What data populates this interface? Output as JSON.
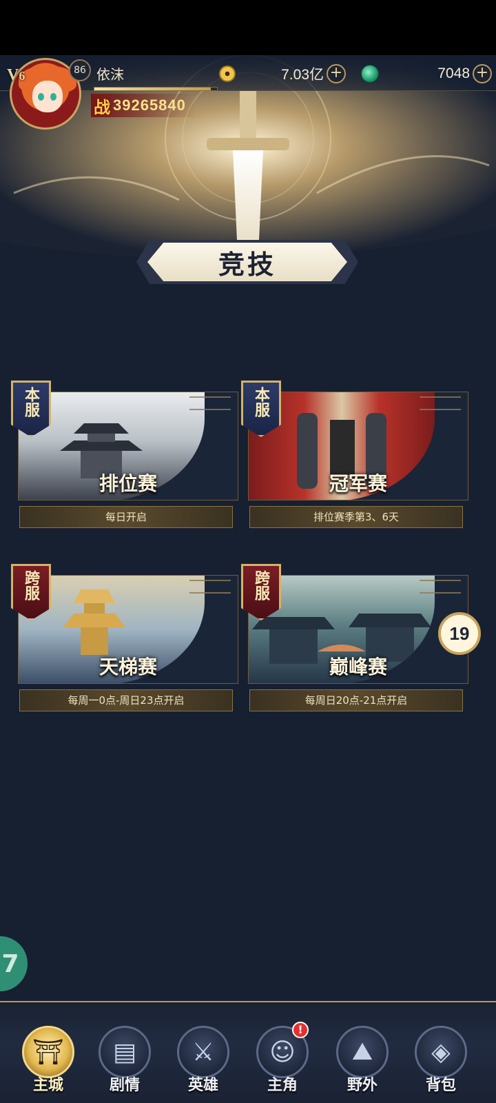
{
  "player": {
    "name": "依沫",
    "vip_prefix": "V",
    "vip_level": "6",
    "level": "86",
    "power_char": "战",
    "power": "39265840",
    "exp_progress": 0.95
  },
  "currencies": [
    {
      "icon": "coin-icon",
      "value": "7.03亿"
    },
    {
      "icon": "jade-icon",
      "value": "7048"
    }
  ],
  "page_title": "竞技",
  "modes": [
    {
      "tag": "本服",
      "title": "排位赛",
      "subtitle": "每日开启"
    },
    {
      "tag": "本服",
      "title": "冠军赛",
      "subtitle": "排位赛季第3、6天"
    },
    {
      "tag": "跨服",
      "title": "天梯赛",
      "subtitle": "每周一0点-周日23点开启"
    },
    {
      "tag": "跨服",
      "title": "巅峰赛",
      "subtitle": "每周日20点-21点开启"
    }
  ],
  "chat_bubble": "19",
  "floating_button": "7",
  "nav": [
    {
      "label": "主城",
      "icon": "city-gate-icon",
      "active": true
    },
    {
      "label": "剧情",
      "icon": "story-book-icon"
    },
    {
      "label": "英雄",
      "icon": "hero-icon"
    },
    {
      "label": "主角",
      "icon": "protagonist-icon",
      "badge": "!"
    },
    {
      "label": "野外",
      "icon": "wilderness-icon"
    },
    {
      "label": "背包",
      "icon": "backpack-icon"
    }
  ],
  "colors": {
    "background": "#172031",
    "gold": "#c9a463",
    "power": "#ffe08a",
    "cross_server_tag": "#7a1d25",
    "local_server_tag": "#2d3b68"
  }
}
